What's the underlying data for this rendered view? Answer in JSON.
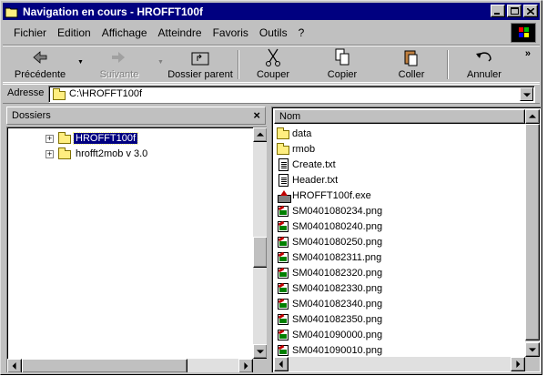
{
  "window": {
    "title": "Navigation en cours - HROFFT100f"
  },
  "menu": [
    "Fichier",
    "Edition",
    "Affichage",
    "Atteindre",
    "Favoris",
    "Outils",
    "?"
  ],
  "toolbar": {
    "back_label": "Précédente",
    "forward_label": "Suivante",
    "up_label": "Dossier parent",
    "cut_label": "Couper",
    "copy_label": "Copier",
    "paste_label": "Coller",
    "undo_label": "Annuler",
    "more_label": "»"
  },
  "address": {
    "label": "Adresse",
    "value": "C:\\HROFFT100f"
  },
  "folders": {
    "title": "Dossiers",
    "close_label": "×",
    "items": [
      {
        "label": "HROFFT100f",
        "selected": true
      },
      {
        "label": "hrofft2mob v 3.0",
        "selected": false
      }
    ]
  },
  "files": {
    "column_name": "Nom",
    "items": [
      {
        "name": "data",
        "icon": "folder-icon"
      },
      {
        "name": "rmob",
        "icon": "folder-icon"
      },
      {
        "name": "Create.txt",
        "icon": "text-file-icon"
      },
      {
        "name": "Header.txt",
        "icon": "text-file-icon"
      },
      {
        "name": "HROFFT100f.exe",
        "icon": "exe-file-icon"
      },
      {
        "name": "SM0401080234.png",
        "icon": "image-file-icon"
      },
      {
        "name": "SM0401080240.png",
        "icon": "image-file-icon"
      },
      {
        "name": "SM0401080250.png",
        "icon": "image-file-icon"
      },
      {
        "name": "SM0401082311.png",
        "icon": "image-file-icon"
      },
      {
        "name": "SM0401082320.png",
        "icon": "image-file-icon"
      },
      {
        "name": "SM0401082330.png",
        "icon": "image-file-icon"
      },
      {
        "name": "SM0401082340.png",
        "icon": "image-file-icon"
      },
      {
        "name": "SM0401082350.png",
        "icon": "image-file-icon"
      },
      {
        "name": "SM0401090000.png",
        "icon": "image-file-icon"
      },
      {
        "name": "SM0401090010.png",
        "icon": "image-file-icon"
      }
    ]
  }
}
